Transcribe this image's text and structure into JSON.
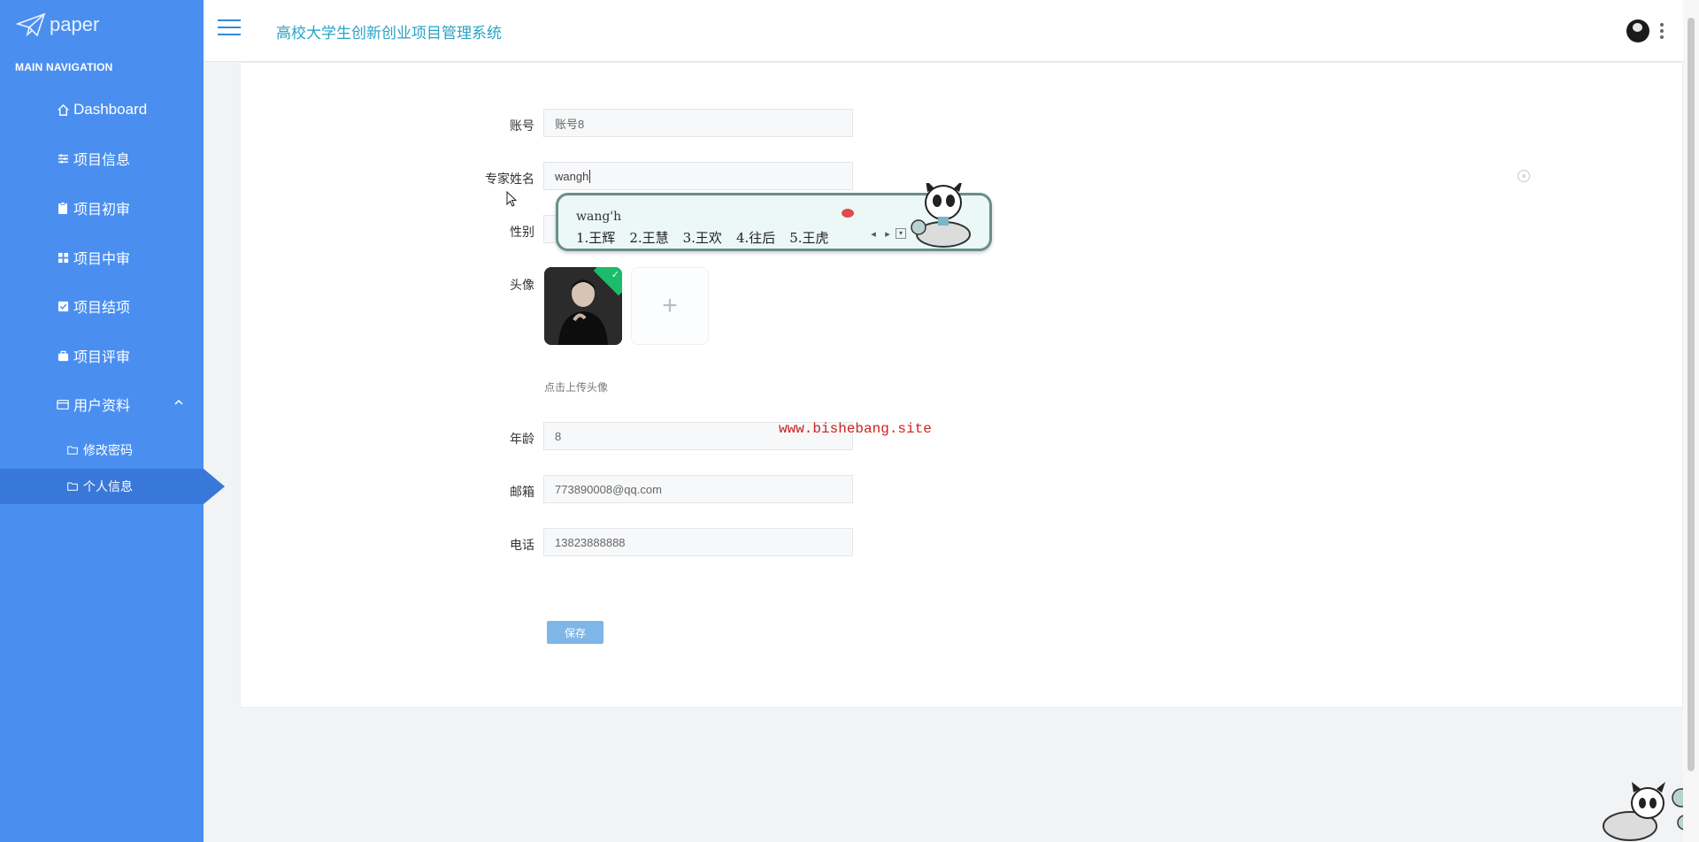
{
  "app": {
    "logo_text": "paper",
    "title": "高校大学生创新创业项目管理系统"
  },
  "sidebar": {
    "caption": "MAIN NAVIGATION",
    "items": [
      {
        "label": "Dashboard",
        "icon": "home-icon"
      },
      {
        "label": "项目信息",
        "icon": "sliders-icon"
      },
      {
        "label": "项目初审",
        "icon": "clipboard-icon"
      },
      {
        "label": "项目中审",
        "icon": "grid-icon"
      },
      {
        "label": "项目结项",
        "icon": "check-square-icon"
      },
      {
        "label": "项目评审",
        "icon": "briefcase-icon"
      },
      {
        "label": "用户资料",
        "icon": "card-icon",
        "expanded": true
      }
    ],
    "sub_items": [
      {
        "label": "修改密码",
        "icon": "folder-icon"
      },
      {
        "label": "个人信息",
        "icon": "folder-icon",
        "active": true
      }
    ]
  },
  "form": {
    "account": {
      "label": "账号",
      "value": "账号8"
    },
    "expert_name": {
      "label": "专家姓名",
      "value": "wangh"
    },
    "gender": {
      "label": "性别",
      "value": ""
    },
    "avatar": {
      "label": "头像",
      "add_symbol": "+",
      "tip": "点击上传头像"
    },
    "age": {
      "label": "年龄",
      "value": "8"
    },
    "email": {
      "label": "邮箱",
      "value": "773890008@qq.com"
    },
    "phone": {
      "label": "电话",
      "value": "13823888888"
    },
    "save_label": "保存"
  },
  "ime": {
    "composition": "wang'h",
    "candidates": [
      "1.王辉",
      "2.王慧",
      "3.王欢",
      "4.往后",
      "5.王虎"
    ]
  },
  "watermark": "www.bishebang.site",
  "colors": {
    "sidebar": "#4a8ff0",
    "sidebar_active": "#3878d8",
    "title": "#28a3c7",
    "save_button": "#7fb6e8",
    "watermark": "#cc2222"
  }
}
